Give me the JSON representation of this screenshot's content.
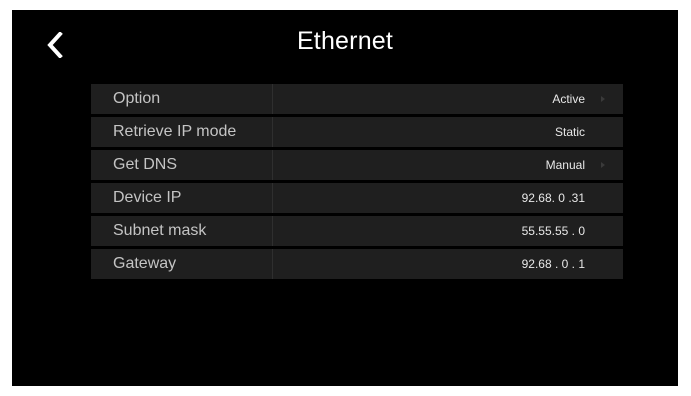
{
  "header": {
    "back_icon": "chevron-left-icon",
    "title": "Ethernet"
  },
  "settings": {
    "rows": [
      {
        "label": "Option",
        "value": "Active",
        "has_arrow": true
      },
      {
        "label": "Retrieve IP mode",
        "value": "Static",
        "has_arrow": false
      },
      {
        "label": "Get DNS",
        "value": "Manual",
        "has_arrow": true
      },
      {
        "label": "Device IP",
        "value": "92.68. 0 .31",
        "has_arrow": false
      },
      {
        "label": "Subnet mask",
        "value": "55.55.55 . 0",
        "has_arrow": false
      },
      {
        "label": "Gateway",
        "value": "92.68 . 0 . 1",
        "has_arrow": false
      }
    ]
  },
  "colors": {
    "background": "#000000",
    "row_background": "#1f1f1f",
    "label_text": "#c4c4c4",
    "value_text": "#e8e8e8"
  }
}
